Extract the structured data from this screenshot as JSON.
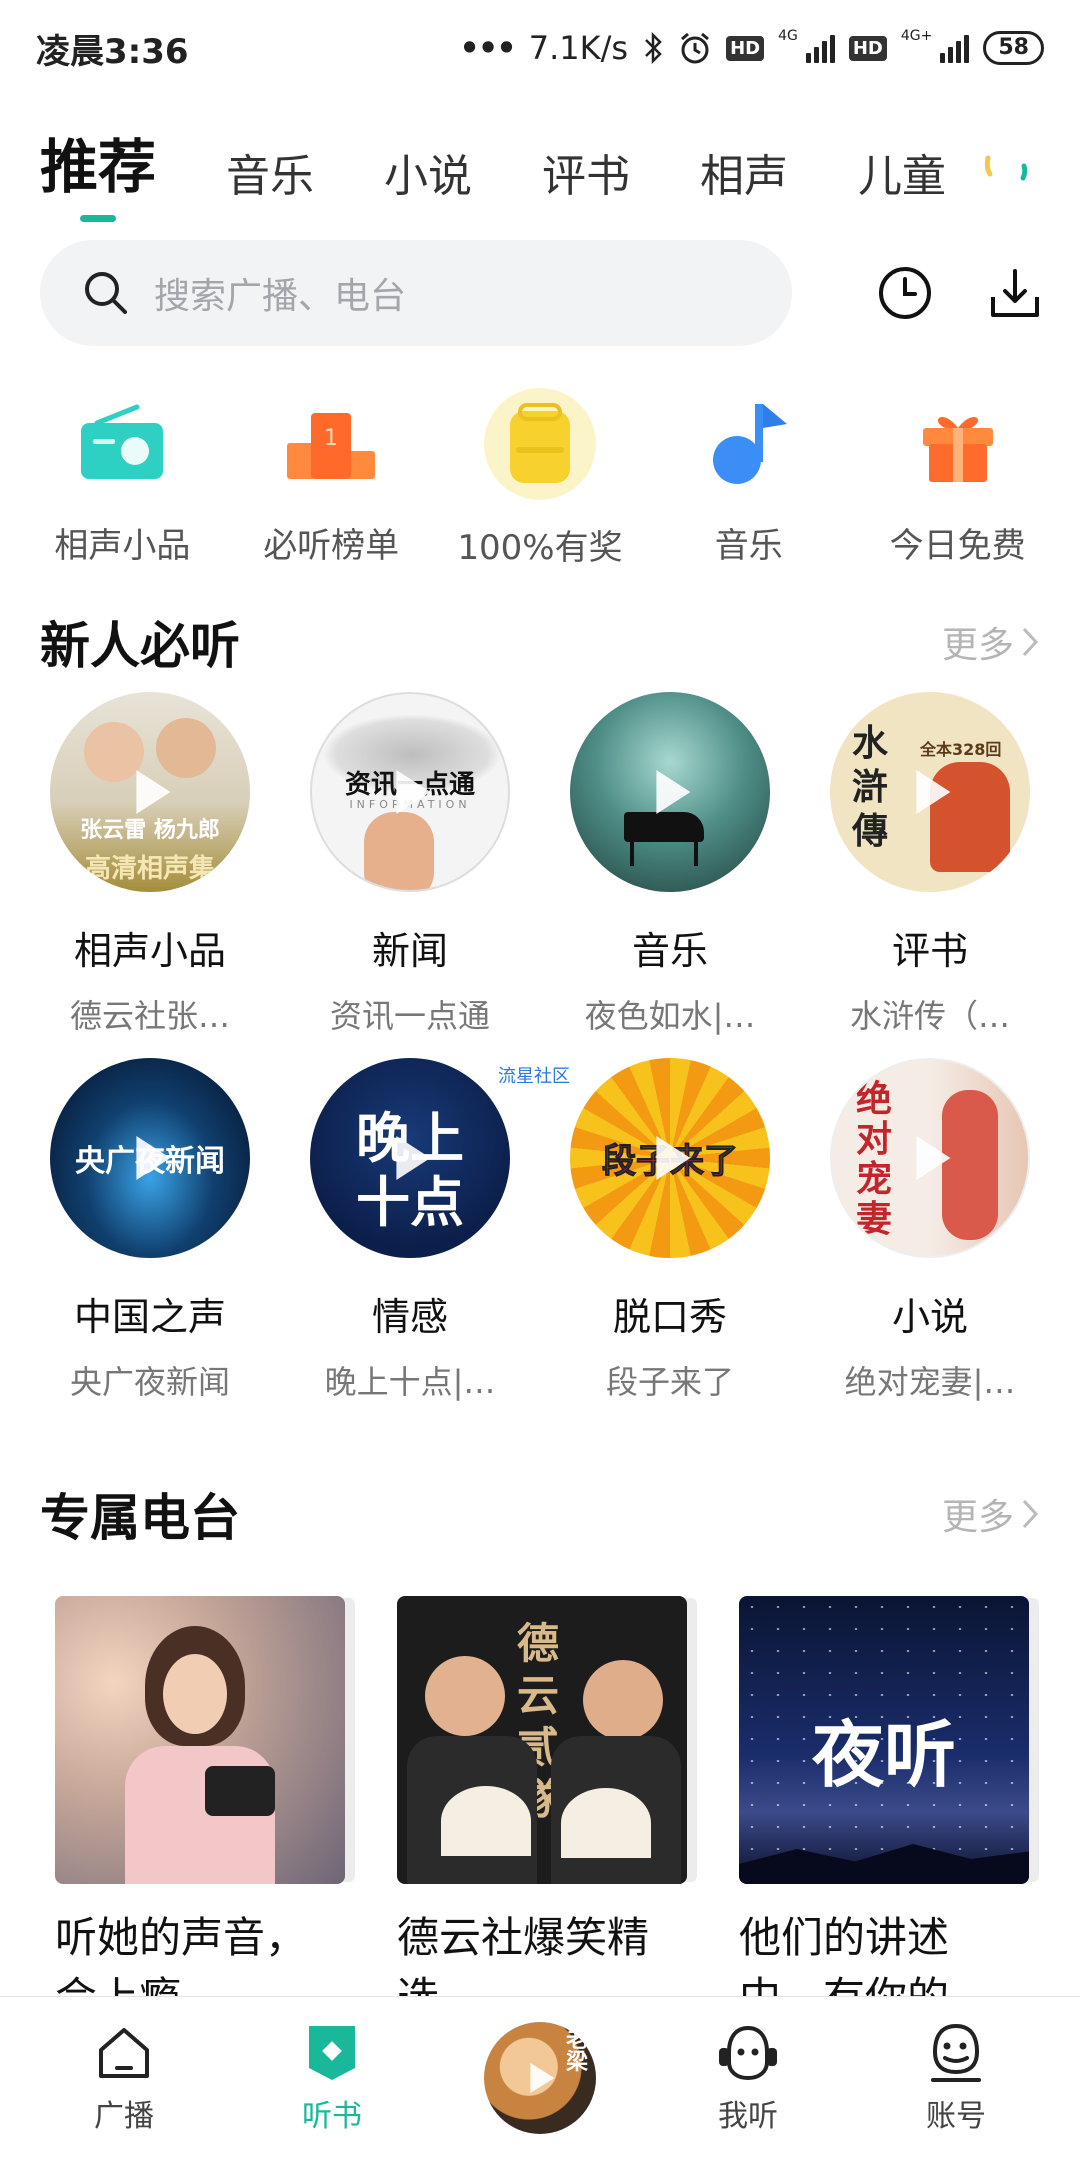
{
  "status_bar": {
    "time": "凌晨3:36",
    "speed": "7.1K/s",
    "net1": "4G",
    "net2": "4G+",
    "hd": "HD",
    "battery": "58"
  },
  "tabs": [
    {
      "label": "推荐",
      "active": true
    },
    {
      "label": "音乐"
    },
    {
      "label": "小说"
    },
    {
      "label": "评书"
    },
    {
      "label": "相声"
    },
    {
      "label": "儿童"
    }
  ],
  "search": {
    "placeholder": "搜索广播、电台"
  },
  "quick_links": [
    {
      "label": "相声小品",
      "icon": "radio-icon"
    },
    {
      "label": "必听榜单",
      "icon": "podium-icon"
    },
    {
      "label": "100%有奖",
      "icon": "backpack-icon"
    },
    {
      "label": "音乐",
      "icon": "music-note-icon"
    },
    {
      "label": "今日免费",
      "icon": "gift-icon"
    }
  ],
  "section_new": {
    "title": "新人必听",
    "more": "更多",
    "items": [
      {
        "title": "相声小品",
        "subtitle": "德云社张…",
        "art_text_top": "张云雷 杨九郎",
        "art_text_bottom": "高清相声集"
      },
      {
        "title": "新闻",
        "subtitle": "资讯一点通",
        "art_text_top": "资讯一点通",
        "art_text_bottom": "INFORMATION"
      },
      {
        "title": "音乐",
        "subtitle": "夜色如水|…"
      },
      {
        "title": "评书",
        "subtitle": "水浒传（…",
        "art_text_top": "水滸傳",
        "art_text_bottom": "全本328回"
      },
      {
        "title": "中国之声",
        "subtitle": "央广夜新闻",
        "art_text_top": "央广夜新闻"
      },
      {
        "title": "情感",
        "subtitle": "晚上十点|…",
        "art_text_top": "晚上",
        "art_text_bottom": "十点",
        "art_watermark": "流星社区"
      },
      {
        "title": "脱口秀",
        "subtitle": "段子来了",
        "art_text_top": "段子来了"
      },
      {
        "title": "小说",
        "subtitle": "绝对宠妻|…",
        "art_text_top": "绝对宠妻"
      }
    ]
  },
  "section_radio": {
    "title": "专属电台",
    "more": "更多",
    "cards": [
      {
        "title": "听她的声音，会上瘾"
      },
      {
        "title": "德云社爆笑精选",
        "art_text": "德云 贰 隊"
      },
      {
        "title": "他们的讲述中，有你的",
        "art_text": "夜听"
      }
    ]
  },
  "bottom_nav": [
    {
      "label": "广播",
      "icon": "house-icon"
    },
    {
      "label": "听书",
      "icon": "bookmark-icon",
      "active": true
    },
    {
      "label": "",
      "icon": "now-playing-disc"
    },
    {
      "label": "我听",
      "icon": "headphones-face-icon"
    },
    {
      "label": "账号",
      "icon": "account-face-icon"
    }
  ],
  "colors": {
    "accent": "#19b89b",
    "quick_radio": "#2fd0c4",
    "quick_podium": "#ff6a2a",
    "quick_backpack": "#f7d22f",
    "quick_music": "#3a8ef6",
    "quick_gift": "#ff6b2c"
  }
}
